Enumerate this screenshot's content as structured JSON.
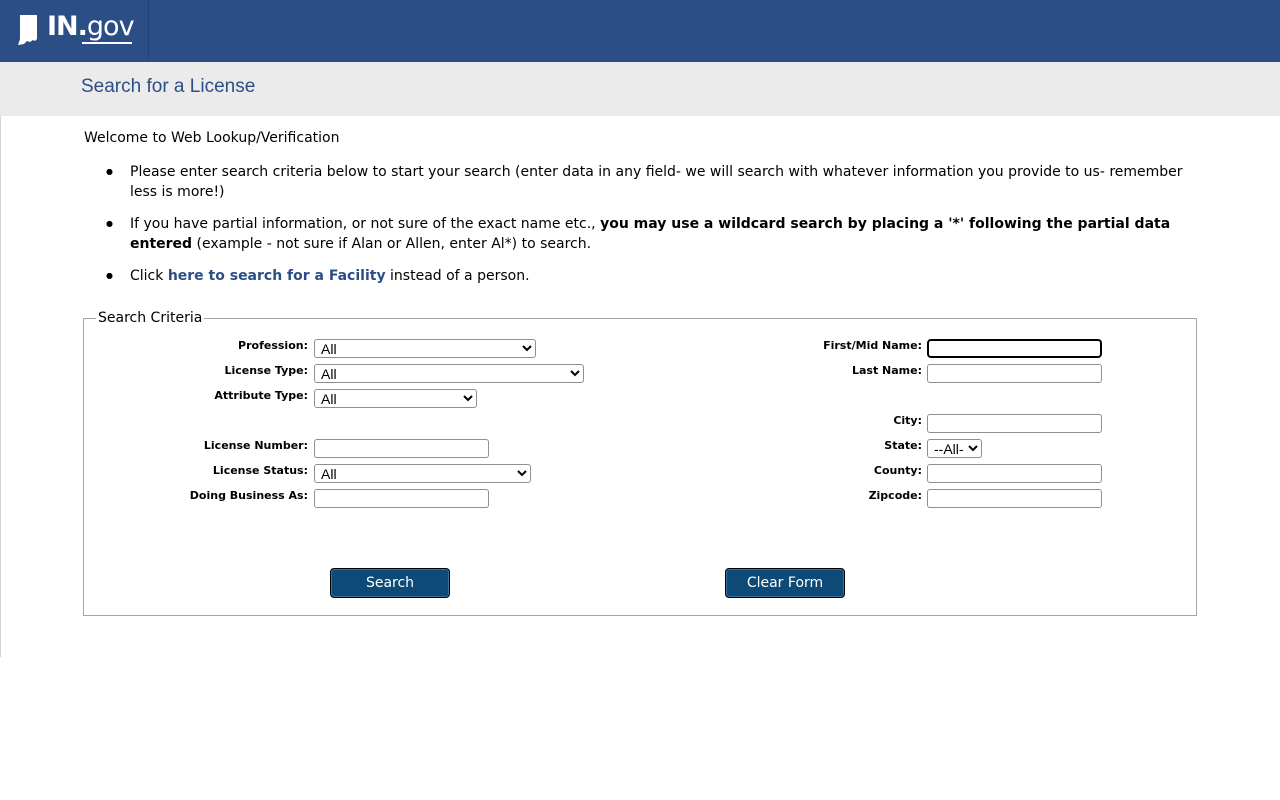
{
  "header": {
    "logo": {
      "in": "IN",
      "dot": ".",
      "gov": "gov",
      "icon": "indiana-state-icon"
    }
  },
  "page": {
    "title": "Search for a License"
  },
  "intro": {
    "welcome": "Welcome to Web Lookup/Verification",
    "bullet1": "Please enter search criteria below to start your search (enter data in any field- we will search with whatever information you provide to us- remember less is more!)",
    "bullet2_pre": "If you have partial information, or not sure of the exact name etc., ",
    "bullet2_bold": "you may use a wildcard search by placing a '*' following the partial data entered",
    "bullet2_post": " (example - not sure if Alan or Allen, enter Al*) to search.",
    "bullet3_pre": "Click ",
    "bullet3_link": "here to search for a Facility",
    "bullet3_post": " instead of a person."
  },
  "form": {
    "legend": "Search Criteria",
    "left": {
      "profession": {
        "label": "Profession:",
        "value": "All"
      },
      "license_type": {
        "label": "License Type:",
        "value": "All"
      },
      "attribute_type": {
        "label": "Attribute Type:",
        "value": "All"
      },
      "license_number": {
        "label": "License Number:",
        "value": ""
      },
      "license_status": {
        "label": "License Status:",
        "value": "All"
      },
      "dba": {
        "label": "Doing Business As:",
        "value": ""
      }
    },
    "right": {
      "first_mid": {
        "label": "First/Mid Name:",
        "value": ""
      },
      "last": {
        "label": "Last Name:",
        "value": ""
      },
      "city": {
        "label": "City:",
        "value": ""
      },
      "state": {
        "label": "State:",
        "value": "--All--"
      },
      "county": {
        "label": "County:",
        "value": ""
      },
      "zip": {
        "label": "Zipcode:",
        "value": ""
      }
    },
    "search_button": "Search",
    "clear_button": "Clear Form"
  }
}
